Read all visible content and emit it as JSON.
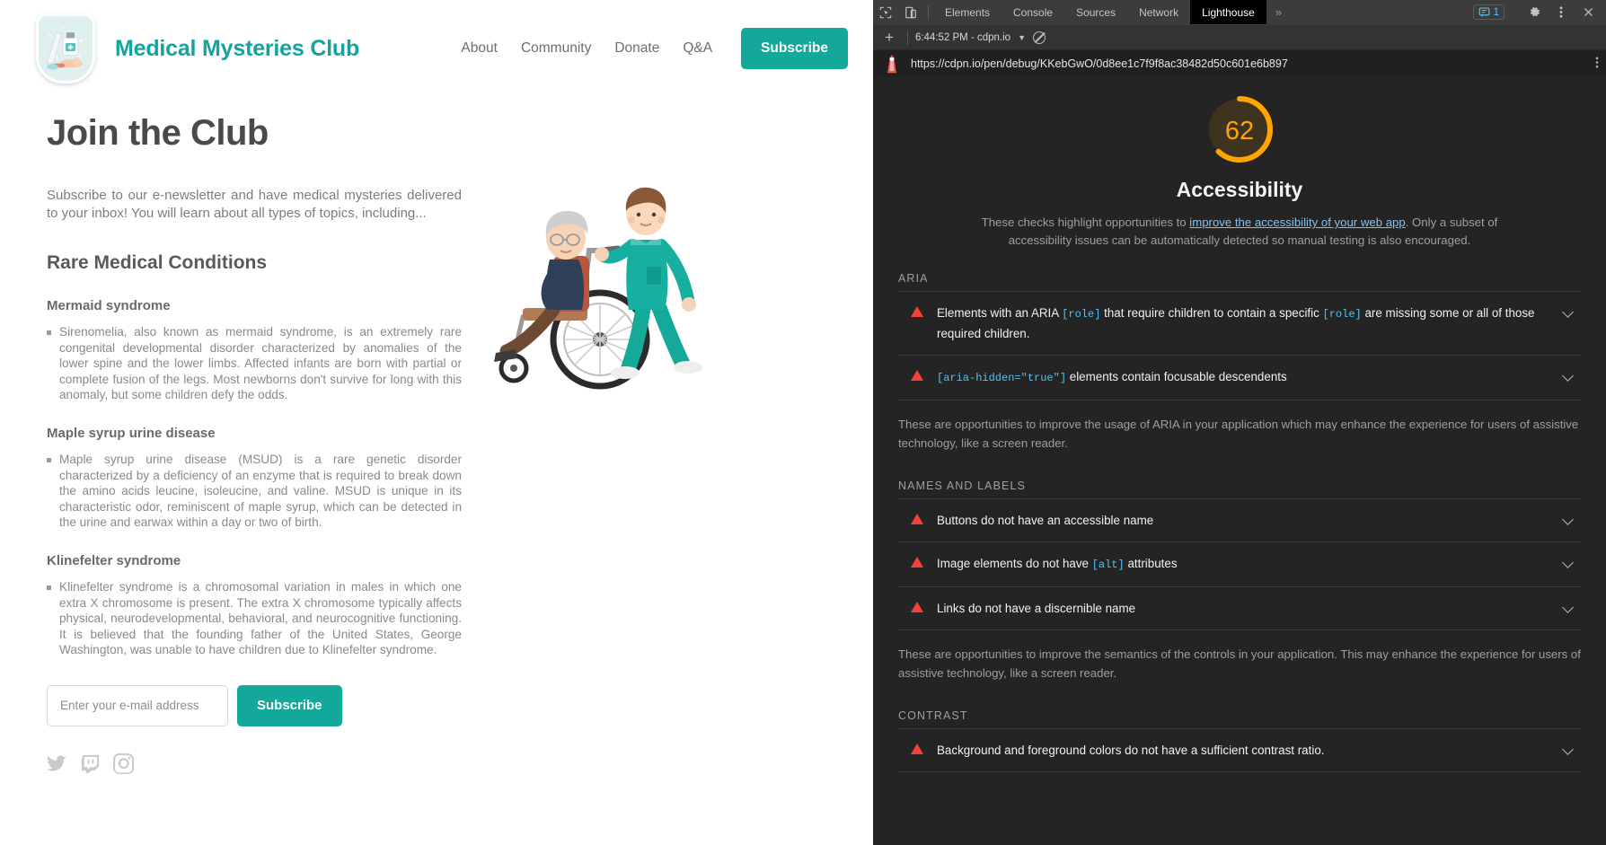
{
  "site": {
    "brand": "Medical Mysteries Club",
    "logo_icon": "medical-shield-badge-icon",
    "nav": [
      {
        "label": "About"
      },
      {
        "label": "Community"
      },
      {
        "label": "Donate"
      },
      {
        "label": "Q&A"
      }
    ],
    "nav_cta": "Subscribe",
    "page_title": "Join the Club",
    "intro": "Subscribe to our e-newsletter and have medical mysteries delivered to your inbox! You will learn about all types of topics, including...",
    "section_title": "Rare Medical Conditions",
    "conditions": [
      {
        "term": "Mermaid syndrome",
        "definition": "Sirenomelia, also known as mermaid syndrome, is an extremely rare congenital developmental disorder characterized by anomalies of the lower spine and the lower limbs. Affected infants are born with partial or complete fusion of the legs. Most newborns don't survive for long with this anomaly, but some children defy the odds."
      },
      {
        "term": "Maple syrup urine disease",
        "definition": "Maple syrup urine disease (MSUD) is a rare genetic disorder characterized by a deficiency of an enzyme that is required to break down the amino acids leucine, isoleucine, and valine. MSUD is unique in its characteristic odor, reminiscent of maple syrup, which can be detected in the urine and earwax within a day or two of birth."
      },
      {
        "term": "Klinefelter syndrome",
        "definition": "Klinefelter syndrome is a chromosomal variation in males in which one extra X chromosome is present. The extra X chromosome typically affects physical, neurodevelopmental, behavioral, and neurocognitive functioning. It is believed that the founding father of the United States, George Washington, was unable to have children due to Klinefelter syndrome."
      }
    ],
    "form": {
      "email_placeholder": "Enter your e-mail address",
      "email_value": "",
      "submit_label": "Subscribe"
    },
    "socials": [
      {
        "name": "twitter-icon"
      },
      {
        "name": "twitch-icon"
      },
      {
        "name": "instagram-icon"
      }
    ],
    "illustration_name": "nurse-pushing-wheelchair-illustration",
    "accent_color": "#13a899",
    "brand_color": "#13a3a0"
  },
  "devtools": {
    "tabs": [
      {
        "label": "Elements",
        "active": false
      },
      {
        "label": "Console",
        "active": false
      },
      {
        "label": "Sources",
        "active": false
      },
      {
        "label": "Network",
        "active": false
      },
      {
        "label": "Lighthouse",
        "active": true
      }
    ],
    "overflow_label": "»",
    "issues_count": "1",
    "inspect_icon": "inspect-element-icon",
    "device_icon": "device-toolbar-icon",
    "settings_icon": "gear-icon",
    "kebab_icon": "more-options-icon",
    "close_icon": "close-icon",
    "subbar": {
      "add_icon": "plus-icon",
      "run_label": "6:44:52 PM - cdpn.io",
      "dropdown_icon": "chevron-down-icon",
      "clear_icon": "clear-icon"
    },
    "url": "https://cdpn.io/pen/debug/KKebGwO/0d8ee1c7f9f8ac38482d50c601e6b897",
    "lighthouse_icon": "lighthouse-icon"
  },
  "lighthouse": {
    "score": "62",
    "score_color": "#ffa400",
    "score_percent": 62,
    "category": "Accessibility",
    "description_parts": {
      "before": "These checks highlight opportunities to ",
      "link": "improve the accessibility of your web app",
      "after": ". Only a subset of accessibility issues can be automatically detected so manual testing is also encouraged."
    },
    "groups": [
      {
        "title": "ARIA",
        "audits": [
          {
            "icon": "warning-triangle-icon",
            "parts": [
              {
                "text": "Elements with an ARIA ",
                "code": false
              },
              {
                "text": "[role]",
                "code": true
              },
              {
                "text": " that require children to contain a specific ",
                "code": false
              },
              {
                "text": "[role]",
                "code": true
              },
              {
                "text": " are missing some or all of those required children.",
                "code": false
              }
            ]
          },
          {
            "icon": "warning-triangle-icon",
            "parts": [
              {
                "text": "[aria-hidden=\"true\"]",
                "code": true
              },
              {
                "text": " elements contain focusable descendents",
                "code": false
              }
            ]
          }
        ],
        "description": "These are opportunities to improve the usage of ARIA in your application which may enhance the experience for users of assistive technology, like a screen reader."
      },
      {
        "title": "NAMES AND LABELS",
        "audits": [
          {
            "icon": "warning-triangle-icon",
            "parts": [
              {
                "text": "Buttons do not have an accessible name",
                "code": false
              }
            ]
          },
          {
            "icon": "warning-triangle-icon",
            "parts": [
              {
                "text": "Image elements do not have ",
                "code": false
              },
              {
                "text": "[alt]",
                "code": true
              },
              {
                "text": " attributes",
                "code": false
              }
            ]
          },
          {
            "icon": "warning-triangle-icon",
            "parts": [
              {
                "text": "Links do not have a discernible name",
                "code": false
              }
            ]
          }
        ],
        "description": "These are opportunities to improve the semantics of the controls in your application. This may enhance the experience for users of assistive technology, like a screen reader."
      },
      {
        "title": "CONTRAST",
        "audits": [
          {
            "icon": "warning-triangle-icon",
            "parts": [
              {
                "text": "Background and foreground colors do not have a sufficient contrast ratio.",
                "code": false
              }
            ]
          }
        ],
        "description": ""
      }
    ]
  }
}
